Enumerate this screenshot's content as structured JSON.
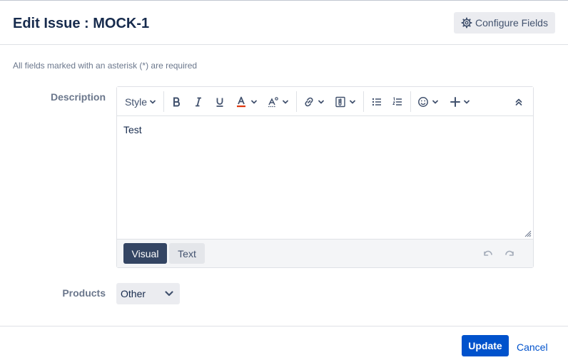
{
  "header": {
    "title": "Edit Issue : MOCK-1",
    "configure_fields_label": "Configure Fields"
  },
  "required_note": "All fields marked with an asterisk (*) are required",
  "description": {
    "label": "Description",
    "toolbar": {
      "style_label": "Style",
      "items": [
        "bold-icon",
        "italic-icon",
        "underline-icon",
        "text-color-icon",
        "text-format-icon",
        "link-icon",
        "attachment-icon",
        "bullet-list-icon",
        "numbered-list-icon",
        "emoji-icon",
        "insert-plus-icon",
        "collapse-icon"
      ]
    },
    "content": "Test",
    "modes": {
      "visual": "Visual",
      "text": "Text",
      "active": "Visual"
    }
  },
  "products": {
    "label": "Products",
    "selected": "Other"
  },
  "footer": {
    "update_label": "Update",
    "cancel_label": "Cancel"
  },
  "colors": {
    "primary": "#0052cc",
    "text_color_underline": "#de350b",
    "visual_active_bg": "#344563"
  }
}
